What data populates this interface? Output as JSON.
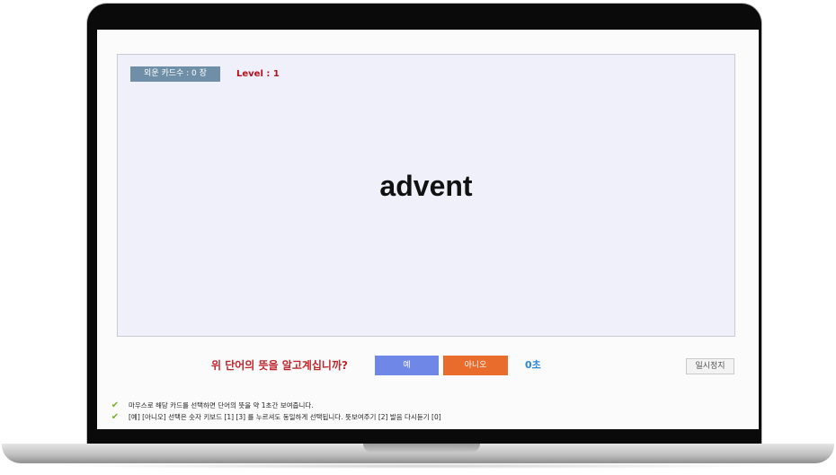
{
  "card": {
    "learned_count_label": "외운 카드수 : 0 장",
    "level_label": "Level : 1",
    "word": "advent"
  },
  "quiz": {
    "question": "위 단어의 뜻을 알고계십니까?",
    "yes_label": "예",
    "no_label": "아니오",
    "timer": "0초",
    "pause_label": "일시정지"
  },
  "help": {
    "icon": "check-icon",
    "check_color": "#79b320",
    "lines": [
      "마우스로 해당 카드를 선택하면 단어의 뜻을 약 1초간 보여줍니다.",
      "[예] [아니오] 선택은 숫자 키보드 [1] [3] 를 누르셔도 동일하게 선택됩니다. 뜻보여주기 [2] 발음 다시듣기 [0]"
    ]
  },
  "colors": {
    "card_bg": "#eff0fa",
    "badge_bg": "#6f8fa8",
    "level": "#b3121d",
    "question": "#c0262d",
    "yes_button": "#6f87e6",
    "no_button": "#ea6c2c",
    "timer": "#2f86d3"
  }
}
